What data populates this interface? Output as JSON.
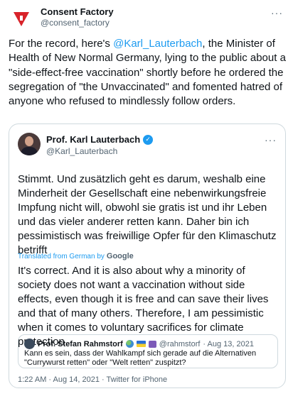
{
  "main_tweet": {
    "author_name": "Consent Factory",
    "author_handle": "@consent_factory",
    "text_before_mention": "For the record, here's ",
    "mention": "@Karl_Lauterbach",
    "text_after_mention": ", the Minister of Health of New Normal Germany, lying to the public about a \"side-effect-free vaccination\" shortly before he ordered the segregation of \"the Unvaccinated\" and fomented hatred of anyone who refused to mindlessly follow orders.",
    "more_label": "···"
  },
  "quoted_tweet": {
    "author_name": "Prof. Karl Lauterbach",
    "author_handle": "@Karl_Lauterbach",
    "more_label": "···",
    "original_text": "Stimmt. Und zusätzlich geht es darum, weshalb eine Minderheit der Gesellschaft eine nebenwirkungsfreie Impfung nicht will, obwohl sie gratis ist und ihr Leben und das vieler anderer retten kann. Daher bin ich pessimistisch was freiwillige Opfer für den Klimaschutz betrifft",
    "translated_label": "Translated from German by",
    "translator_name": "Google",
    "translated_text": "It's correct. And it is also about why a minority of society does not want a vaccination without side effects, even though it is free and can save their lives and that of many others. Therefore, I am pessimistic when it comes to voluntary sacrifices for climate protection",
    "timestamp": "1:22 AM · Aug 14, 2021 · Twitter for iPhone"
  },
  "inner_quote": {
    "author_name": "Prof. Stefan Rahmstorf",
    "author_handle": "@rahmstorf",
    "date": "· Aug 13, 2021",
    "text": "Kann es sein, dass der Wahlkampf sich gerade auf die Alternativen \"Currywurst retten\" oder \"Welt retten\" zuspitzt?"
  },
  "colors": {
    "accent": "#1d9bf0",
    "logo_red": "#d8232a",
    "text": "#0f1419",
    "muted": "#536471",
    "border": "#cfd9de"
  },
  "icons": {
    "verified": "verified-badge-icon",
    "more": "more-options-icon",
    "logo": "consent-factory-logo"
  }
}
